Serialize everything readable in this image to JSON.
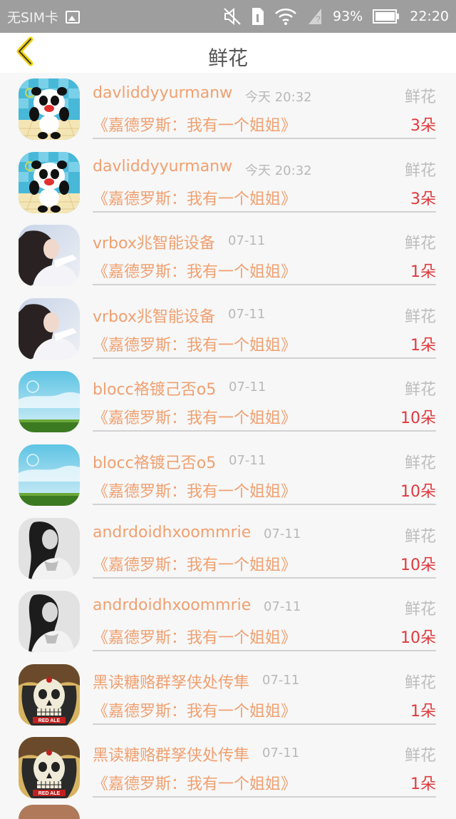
{
  "status_bar": {
    "carrier": "无SIM卡",
    "battery_percent": "93%",
    "time": "22:20"
  },
  "nav": {
    "title": "鲜花",
    "back_icon": "chevron-left-icon"
  },
  "colors": {
    "accent_orange": "#f0a070",
    "count_red": "#e0393e",
    "muted_gray": "#bdbdbd",
    "back_icon_yellow": "#f0d000"
  },
  "items": [
    {
      "username": "davliddyyurmanw",
      "time": "今天 20:32",
      "gift_type": "鲜花",
      "book_title": "《嘉德罗斯：我有一个姐姐》",
      "count": "3朵",
      "avatar": "panda"
    },
    {
      "username": "davliddyyurmanw",
      "time": "今天 20:32",
      "gift_type": "鲜花",
      "book_title": "《嘉德罗斯：我有一个姐姐》",
      "count": "3朵",
      "avatar": "panda"
    },
    {
      "username": "vrbox兆智能设备",
      "time": "07-11",
      "gift_type": "鲜花",
      "book_title": "《嘉德罗斯：我有一个姐姐》",
      "count": "1朵",
      "avatar": "girl-color"
    },
    {
      "username": "vrbox兆智能设备",
      "time": "07-11",
      "gift_type": "鲜花",
      "book_title": "《嘉德罗斯：我有一个姐姐》",
      "count": "1朵",
      "avatar": "girl-color"
    },
    {
      "username": "blocc袼镀己否o5",
      "time": "07-11",
      "gift_type": "鲜花",
      "book_title": "《嘉德罗斯：我有一个姐姐》",
      "count": "10朵",
      "avatar": "sky"
    },
    {
      "username": "blocc袼镀己否o5",
      "time": "07-11",
      "gift_type": "鲜花",
      "book_title": "《嘉德罗斯：我有一个姐姐》",
      "count": "10朵",
      "avatar": "sky"
    },
    {
      "username": "andrdoidhxoommrie",
      "time": "07-11",
      "gift_type": "鲜花",
      "book_title": "《嘉德罗斯：我有一个姐姐》",
      "count": "10朵",
      "avatar": "girl-bw"
    },
    {
      "username": "andrdoidhxoommrie",
      "time": "07-11",
      "gift_type": "鲜花",
      "book_title": "《嘉德罗斯：我有一个姐姐》",
      "count": "10朵",
      "avatar": "girl-bw"
    },
    {
      "username": "黑读糖赂群孥侠处传隼",
      "time": "07-11",
      "gift_type": "鲜花",
      "book_title": "《嘉德罗斯：我有一个姐姐》",
      "count": "1朵",
      "avatar": "skull"
    },
    {
      "username": "黑读糖赂群孥侠处传隼",
      "time": "07-11",
      "gift_type": "鲜花",
      "book_title": "《嘉德罗斯：我有一个姐姐》",
      "count": "1朵",
      "avatar": "skull"
    }
  ]
}
